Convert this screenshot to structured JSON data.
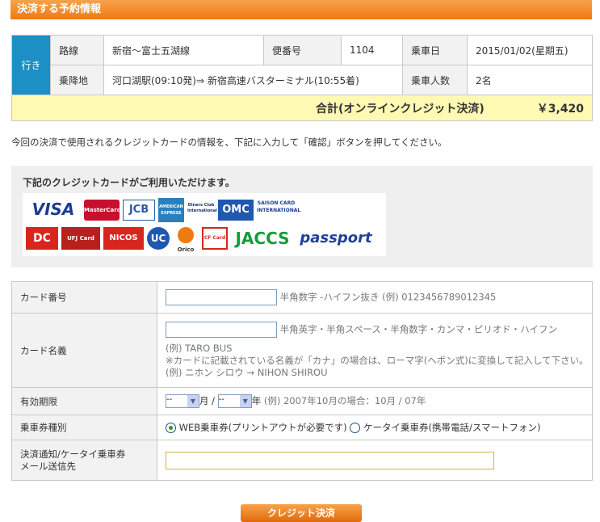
{
  "header": {
    "title": "決済する予約情報"
  },
  "reservation": {
    "direction": "行き",
    "route_label": "路線",
    "route_value": "新宿〜富士五湖線",
    "flight_label": "便番号",
    "flight_value": "1104",
    "date_label": "乗車日",
    "date_value": "2015/01/02(星期五)",
    "stops_label": "乗降地",
    "stops_value": "河口湖駅(09:10発)⇒ 新宿高速バスターミナル(10:55着)",
    "pax_label": "乗車人数",
    "pax_value": "2名",
    "total_label": "合計(オンラインクレジット決済)",
    "total_value": "￥3,420"
  },
  "instructions": "今回の決済で使用されるクレジットカードの情報を、下記に入力して「確認」ボタンを押してください。",
  "cards": {
    "title": "下記のクレジットカードがご利用いただけます。",
    "logos": [
      "VISA",
      "MasterCard",
      "JCB",
      "AMERICAN EXPRESS",
      "Diners Club International",
      "OMC",
      "SAISON CARD INTERNATIONAL",
      "DC",
      "UFJ Card",
      "NICOS",
      "UC",
      "Orico",
      "CF Card",
      "JACCS",
      "passport"
    ]
  },
  "form": {
    "card_number_label": "カード番号",
    "card_number_hint": "半角数字 -ハイフン抜き (例) 0123456789012345",
    "card_name_label": "カード名義",
    "card_name_hint1": "半角英字・半角スペース・半角数字・カンマ・ピリオド・ハイフン",
    "card_name_hint2": "(例) TARO BUS",
    "card_name_hint3": "※カードに記載されている名義が「カナ」の場合は、ローマ字(ヘボン式)に変換して記入して下さい。",
    "card_name_hint4": "(例) ニホン シロウ → NIHON SHIROU",
    "expiry_label": "有効期限",
    "expiry_month": "--",
    "expiry_month_unit": "月 /",
    "expiry_year": "--",
    "expiry_year_unit": "年",
    "expiry_hint": "(例) 2007年10月の場合：10月 / 07年",
    "ticket_label": "乗車券種別",
    "ticket_web": "WEB乗車券(プリントアウトが必要です)",
    "ticket_mobile": "ケータイ乗車券(携帯電話/スマートフォン)",
    "mail_label1": "決済通知/ケータイ乗車券",
    "mail_label2": "メール送信先"
  },
  "submit_label": "クレジット決済",
  "colors": {
    "accent": "#ef7a12",
    "direction_bg": "#1c8fc4",
    "total_bg": "#fff9b3"
  }
}
